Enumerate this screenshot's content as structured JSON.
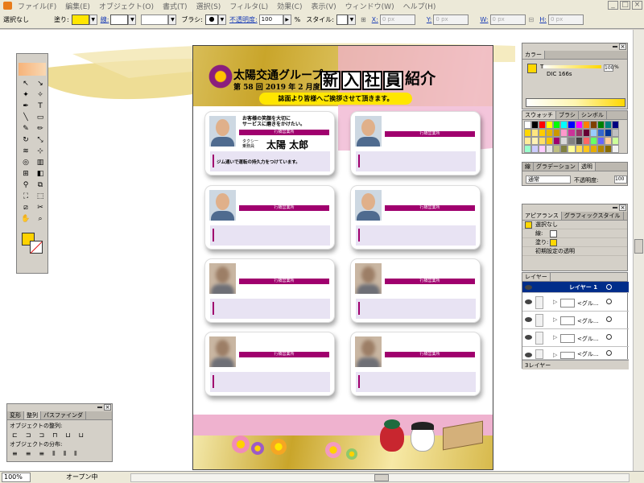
{
  "menubar": {
    "items": [
      "ファイル(F)",
      "編集(E)",
      "オブジェクト(O)",
      "書式(T)",
      "選択(S)",
      "フィルタ(L)",
      "効果(C)",
      "表示(V)",
      "ウィンドウ(W)",
      "ヘルプ(H)"
    ],
    "window_controls": [
      "_",
      "□",
      "×"
    ]
  },
  "control_bar": {
    "selection": "選択なし",
    "fill_label": "塗り:",
    "stroke_label": "線:",
    "brush_label": "ブラシ:",
    "opacity_label": "不透明度:",
    "opacity_value": "100",
    "opacity_unit": "%",
    "style_label": "スタイル:",
    "x_label": "X:",
    "x_value": "0 px",
    "y_label": "Y:",
    "y_value": "0 px",
    "w_label": "W:",
    "w_value": "0 px",
    "h_label": "H:",
    "h_value": "0 px",
    "fill_color": "#ffe600"
  },
  "document": {
    "group_name": "太陽交通グループ",
    "issue": "第 58 回 2019 年 2 月度",
    "headline_chars": [
      "新",
      "入",
      "社",
      "員"
    ],
    "headline_tail": "紹介",
    "subtitle": "誌面より皆様へご挨拶させて頂きます。",
    "cards": [
      {
        "message": [
          "お客様の笑顔を大切に",
          "サービスに磨きをかけたい。"
        ],
        "office": "行橋営業所",
        "role": [
          "タクシー",
          "乗務員"
        ],
        "name": "太陽 太郎",
        "note": "ジム通いで運転の持久力をつけています。",
        "photo": "clear"
      },
      {
        "office": "行橋営業所",
        "photo": "clear"
      },
      {
        "office": "行橋営業所",
        "photo": "clear"
      },
      {
        "office": "行橋営業所",
        "photo": "clear"
      },
      {
        "office": "行橋営業所",
        "photo": "blurred"
      },
      {
        "office": "行橋営業所",
        "photo": "blurred"
      },
      {
        "office": "行橋営業所",
        "photo": "blurred"
      },
      {
        "office": "行橋営業所",
        "photo": "blurred"
      }
    ],
    "accent_color": "#a0006e"
  },
  "color_panel": {
    "title": "カラー",
    "channel": "T",
    "value": "100",
    "unit": "%",
    "spot_name": "DIC 166s",
    "swatch_color": "#ffd700"
  },
  "swatches_panel": {
    "tabs": [
      "スウォッチ",
      "ブラシ",
      "シンボル"
    ],
    "colors": [
      "#ffffff",
      "#000000",
      "#ff0000",
      "#ffff00",
      "#00ff00",
      "#00ffff",
      "#0000ff",
      "#ff00ff",
      "#ff8000",
      "#804000",
      "#008000",
      "#008080",
      "#000080",
      "#ffd700",
      "#ffe680",
      "#ffcc00",
      "#e6b800",
      "#cc9900",
      "#ff99cc",
      "#cc3399",
      "#993366",
      "#660033",
      "#99ccff",
      "#3366cc",
      "#003399",
      "#c0c0c0",
      "#ffeb99",
      "#fff2b3",
      "#ffe066",
      "#f5c400",
      "#a0006e",
      "#d9d9d9",
      "#808080",
      "#404040",
      "#ff6666",
      "#66ff66",
      "#6666ff",
      "#ffcc99",
      "#ccff99",
      "#99ffcc",
      "#ccccff",
      "#ffccff",
      "#e6e6e6",
      "#bfbf80",
      "#808040",
      "#ffff99",
      "#ffdd55",
      "#ffc61a",
      "#e6ac00",
      "#b38600",
      "#8a6d00",
      "#f2f2f2"
    ]
  },
  "gradient_panel": {
    "tabs": [
      "線",
      "グラデーション",
      "透明"
    ],
    "blend": "通常",
    "opacity_label": "不透明度:",
    "opacity_value": "100"
  },
  "appearance_panel": {
    "tabs": [
      "アピアランス",
      "グラフィックスタイル"
    ],
    "rows": [
      "選択なし",
      "線:",
      "塗り:",
      "初期設定の透明"
    ]
  },
  "layers_panel": {
    "title": "レイヤー",
    "top_layer": "レイヤー 1",
    "items": [
      "<グル...",
      "<グル...",
      "<グル...",
      "<グル..."
    ],
    "footer": "3レイヤー"
  },
  "align_panel": {
    "tabs": [
      "変形",
      "整列",
      "パスファインダ"
    ],
    "align_objects": "オブジェクトの整列:",
    "distribute_objects": "オブジェクトの分布:"
  },
  "statusbar": {
    "zoom": "100%",
    "status": "オープン中"
  }
}
